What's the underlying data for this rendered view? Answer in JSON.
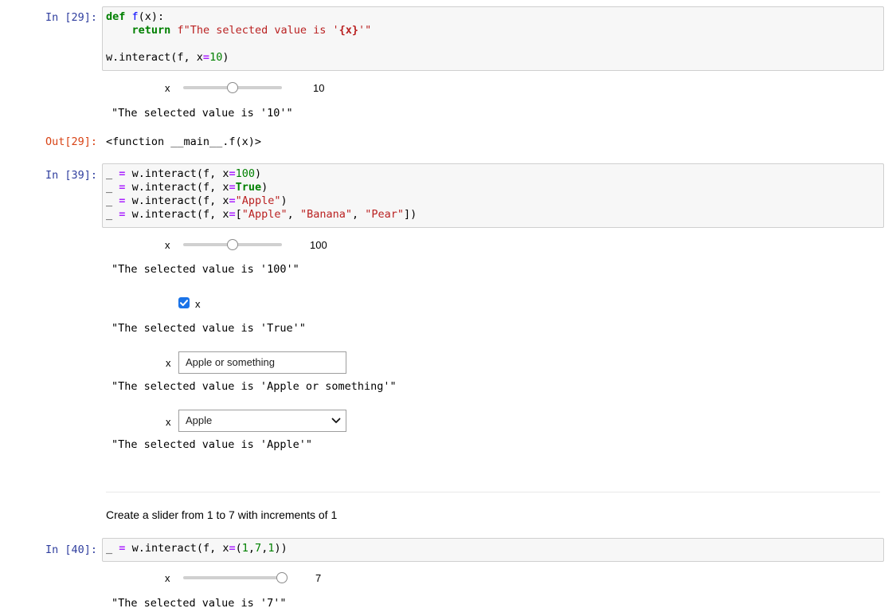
{
  "cells": {
    "c29": {
      "in_prompt": "In [29]:",
      "out_prompt": "Out[29]:",
      "slider_label": "x",
      "slider_value": "10",
      "slider_fraction": 0.5,
      "output_text": "\"The selected value is '10'\"",
      "out_value": "<function __main__.f(x)>"
    },
    "c39": {
      "in_prompt": "In [39]:",
      "slider_label": "x",
      "slider_value": "100",
      "slider_fraction": 0.5,
      "slider_output": "\"The selected value is '100'\"",
      "checkbox_label": "x",
      "checkbox_checked": true,
      "checkbox_output": "\"The selected value is 'True'\"",
      "text_label": "x",
      "text_value": "Apple or something",
      "text_output": "\"The selected value is 'Apple or something'\"",
      "dropdown_label": "x",
      "dropdown_value": "Apple",
      "dropdown_output": "\"The selected value is 'Apple'\""
    },
    "markdown": {
      "text": "Create a slider from 1 to 7 with increments of 1"
    },
    "c40": {
      "in_prompt": "In [40]:",
      "slider_label": "x",
      "slider_value": "7",
      "slider_fraction": 1.0,
      "output_text": "\"The selected value is '7'\""
    }
  },
  "code": {
    "c29": {
      "l1": {
        "def": "def",
        "name": "f",
        "rest": "(x):"
      },
      "l2": {
        "ret": "return",
        "str_a": "f\"The selected value is '",
        "ph": "{x}",
        "str_b": "'\""
      },
      "l4": {
        "a": "w.interact(f, x",
        "eq": "=",
        "num": "10",
        "end": ")"
      }
    },
    "c39": {
      "l1": {
        "us": "_",
        "eq": "=",
        "a": "w.interact(f, x",
        "eq2": "=",
        "num": "100",
        "end": ")"
      },
      "l2": {
        "us": "_",
        "eq": "=",
        "a": "w.interact(f, x",
        "eq2": "=",
        "kc": "True",
        "end": ")"
      },
      "l3": {
        "us": "_",
        "eq": "=",
        "a": "w.interact(f, x",
        "eq2": "=",
        "s": "\"Apple\"",
        "end": ")"
      },
      "l4": {
        "us": "_",
        "eq": "=",
        "a": "w.interact(f, x",
        "eq2": "=",
        "open": "[",
        "s1": "\"Apple\"",
        "c1": ", ",
        "s2": "\"Banana\"",
        "c2": ", ",
        "s3": "\"Pear\"",
        "end": "])"
      }
    },
    "c40": {
      "l1": {
        "us": "_",
        "eq": "=",
        "a": "w.interact(f, x",
        "eq2": "=",
        "p1": "(",
        "n1": "1",
        "c1": ",",
        "n2": "7",
        "c2": ",",
        "n3": "1",
        "end": "))"
      }
    }
  },
  "colors": {
    "prompt_in": "#303f9f",
    "prompt_out": "#d84315",
    "keyword": "#008000",
    "string": "#ba2121",
    "operator": "#aa22ff",
    "checkbox": "#1a73e8"
  },
  "icons": {
    "checkbox": "check-icon",
    "dropdown": "chevron-down-icon"
  }
}
